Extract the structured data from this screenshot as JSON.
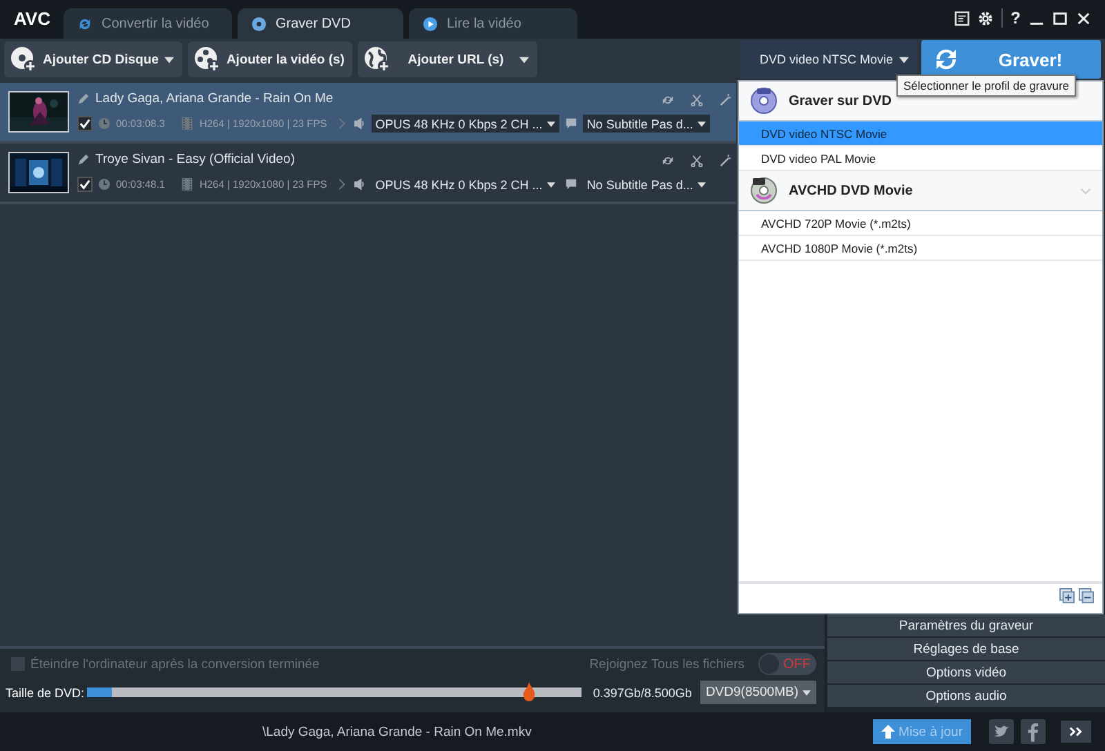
{
  "app": {
    "logo": "AVC"
  },
  "tabs": [
    {
      "label": "Convertir la vidéo",
      "selected": false,
      "kind": "convert"
    },
    {
      "label": "Graver DVD",
      "selected": true,
      "kind": "burn"
    },
    {
      "label": "Lire la vidéo",
      "selected": false,
      "kind": "play"
    }
  ],
  "window_controls": {
    "help": "?"
  },
  "toolbar": [
    {
      "label": "Ajouter CD Disque",
      "kind": "disc",
      "dropdown": true
    },
    {
      "label": "Ajouter la vidéo (s)",
      "kind": "film",
      "dropdown": false
    },
    {
      "label": "Ajouter URL (s)",
      "kind": "globe",
      "dropdown": true
    }
  ],
  "profile_select": {
    "value": "DVD video NTSC Movie"
  },
  "burn_button": {
    "label": "Graver!"
  },
  "tooltip": "Sélectionner le profil de gravure",
  "profile_menu": {
    "groups": [
      {
        "title": "Graver sur DVD",
        "kind": "dvd",
        "items": [
          {
            "label": "DVD video NTSC Movie",
            "selected": true
          },
          {
            "label": "DVD video PAL Movie",
            "selected": false
          }
        ]
      },
      {
        "title": "AVCHD DVD Movie",
        "kind": "hd",
        "items": [
          {
            "label": "AVCHD 720P Movie (*.m2ts)",
            "selected": false
          },
          {
            "label": "AVCHD 1080P Movie (*.m2ts)",
            "selected": false
          }
        ]
      }
    ]
  },
  "files": [
    {
      "title": "Lady Gaga, Ariana Grande - Rain On Me",
      "selected": true,
      "checked": true,
      "duration": "00:03:08.3",
      "video": "H264 | 1920x1080 | 23 FPS",
      "audio": "OPUS 48 KHz 0 Kbps 2 CH ...",
      "subtitle": "No Subtitle Pas d..."
    },
    {
      "title": "Troye Sivan - Easy (Official Video)",
      "selected": false,
      "checked": true,
      "duration": "00:03:48.1",
      "video": "H264 | 1920x1080 | 23 FPS",
      "audio": "OPUS 48 KHz 0 Kbps 2 CH ...",
      "subtitle": "No Subtitle Pas d..."
    }
  ],
  "shutdown_option": {
    "label": "Éteindre l'ordinateur après la conversion terminée",
    "checked": false
  },
  "join_files": {
    "label": "Rejoignez Tous les fichiers",
    "on": false,
    "state_text": "OFF"
  },
  "dvd_size": {
    "label": "Taille de DVD:",
    "level": 0.05,
    "reading": "0.397Gb/8.500Gb",
    "disc": "DVD9(8500MB)"
  },
  "settings_buttons": [
    "Paramètres du graveur",
    "Réglages de base",
    "Options vidéo",
    "Options audio"
  ],
  "status_bar": {
    "path": "\\Lady Gaga, Ariana Grande - Rain On Me.mkv",
    "update": "Mise à jour"
  }
}
